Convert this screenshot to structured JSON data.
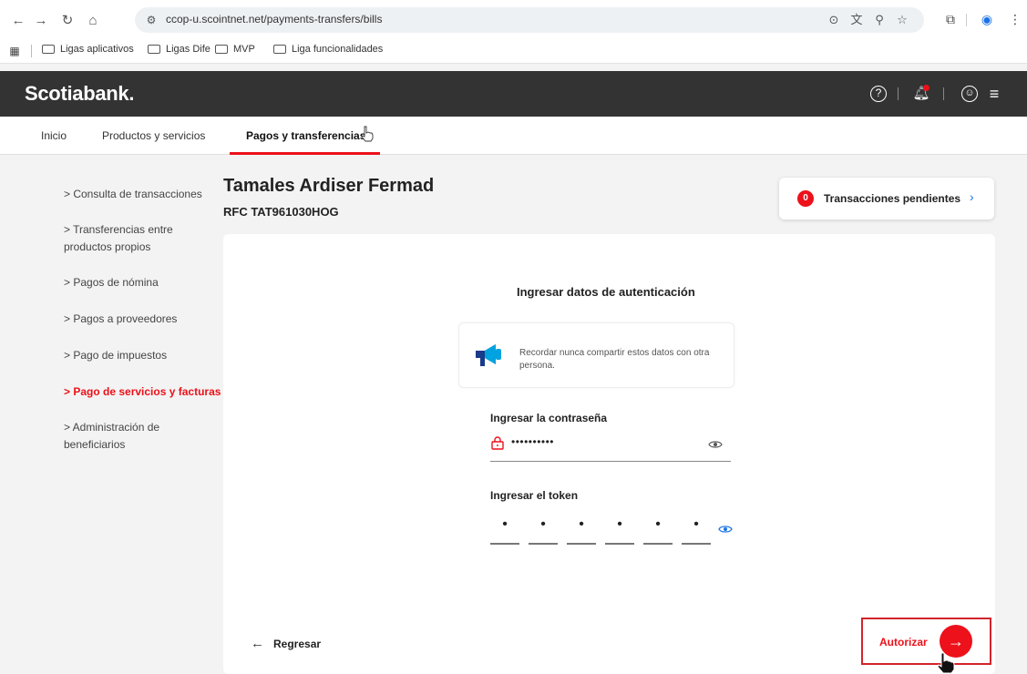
{
  "browser": {
    "url": "ccop-u.scointnet.net/payments-transfers/bills",
    "bookmarks": [
      "Ligas aplicativos",
      "Ligas Dife",
      "MVP",
      "Liga funcionalidades"
    ]
  },
  "header": {
    "logo": "Scotiabank."
  },
  "tabs": {
    "inicio": "Inicio",
    "productos": "Productos y servicios",
    "pagos": "Pagos y transferencias"
  },
  "sidebar": {
    "items": [
      "> Consulta de transacciones",
      "> Transferencias entre productos propios",
      "> Pagos de nómina",
      "> Pagos a proveedores",
      "> Pago de impuestos",
      "> Pago de servicios y facturas",
      "> Administración de beneficiarios"
    ],
    "active_index": 5
  },
  "client": {
    "name": "Tamales Ardiser Fermad",
    "rfc": "RFC TAT961030HOG"
  },
  "pending": {
    "count": "0",
    "label": "Transacciones pendientes"
  },
  "auth": {
    "title": "Ingresar datos de autenticación",
    "note": "Recordar nunca compartir estos datos con otra persona.",
    "password_label": "Ingresar la contraseña",
    "password_value": "••••••••••",
    "token_label": "Ingresar el token",
    "token_digits": [
      "•",
      "•",
      "•",
      "•",
      "•",
      "•"
    ],
    "back_label": "Regresar",
    "authorize_label": "Autorizar"
  },
  "colors": {
    "brand_red": "#ec111a",
    "header_dark": "#333333",
    "link_blue": "#1a73e8"
  }
}
